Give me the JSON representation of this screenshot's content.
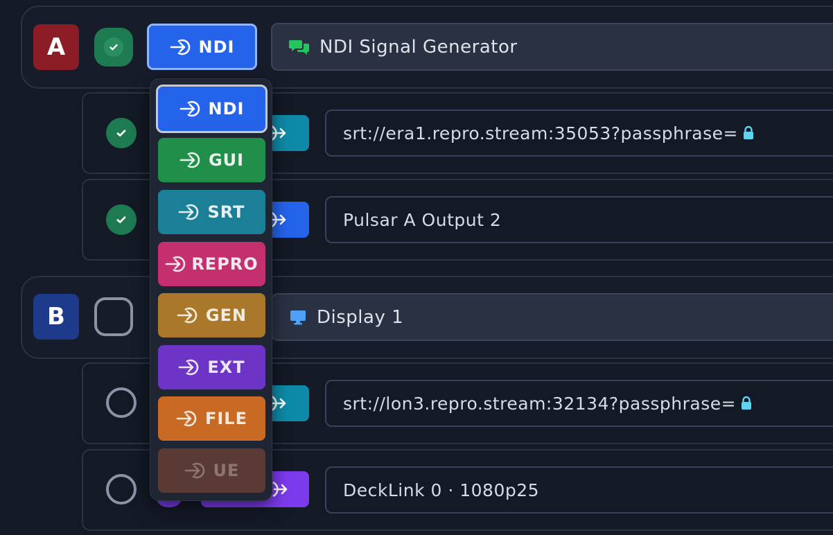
{
  "group_a": {
    "badge": "A",
    "badge_color": "#8c1d27",
    "status": "active",
    "input_type_label": "NDI",
    "input_type_color": "#2563eb",
    "source_icon": "chat-bubbles-icon",
    "source_name": "NDI Signal Generator",
    "outputs": [
      {
        "status": "active",
        "out_icon_color": "#0e8aa8",
        "destination": "srt://era1.repro.stream:35053?passphrase=",
        "locked": true
      },
      {
        "status": "active",
        "out_icon_color": "#2563eb",
        "destination": "Pulsar A Output 2",
        "locked": false
      }
    ]
  },
  "group_b": {
    "badge": "B",
    "badge_color": "#1e3a8a",
    "status": "inactive",
    "source_icon": "monitor-icon",
    "source_name": "Display 1",
    "outputs": [
      {
        "status": "inactive",
        "out_icon_color": "#0e8aa8",
        "destination": "srt://lon3.repro.stream:32134?passphrase=",
        "locked": true
      },
      {
        "status": "inactive",
        "out_icon_color": "#7c3aed",
        "destination": "DeckLink 0 · 1080p25",
        "locked": false
      }
    ]
  },
  "input_type_menu": {
    "selected": "NDI",
    "items": [
      {
        "label": "NDI",
        "color": "#2563eb",
        "selected": true
      },
      {
        "label": "GUI",
        "color": "#1f8f4a",
        "selected": false
      },
      {
        "label": "SRT",
        "color": "#1b7f98",
        "selected": false
      },
      {
        "label": "REPRO",
        "color": "#c42f6d",
        "selected": false
      },
      {
        "label": "GEN",
        "color": "#a9782a",
        "selected": false
      },
      {
        "label": "EXT",
        "color": "#6d35c6",
        "selected": false
      },
      {
        "label": "FILE",
        "color": "#c86a24",
        "selected": false
      },
      {
        "label": "UE",
        "color": "#5a3a34",
        "selected": false,
        "disabled": true
      }
    ]
  }
}
